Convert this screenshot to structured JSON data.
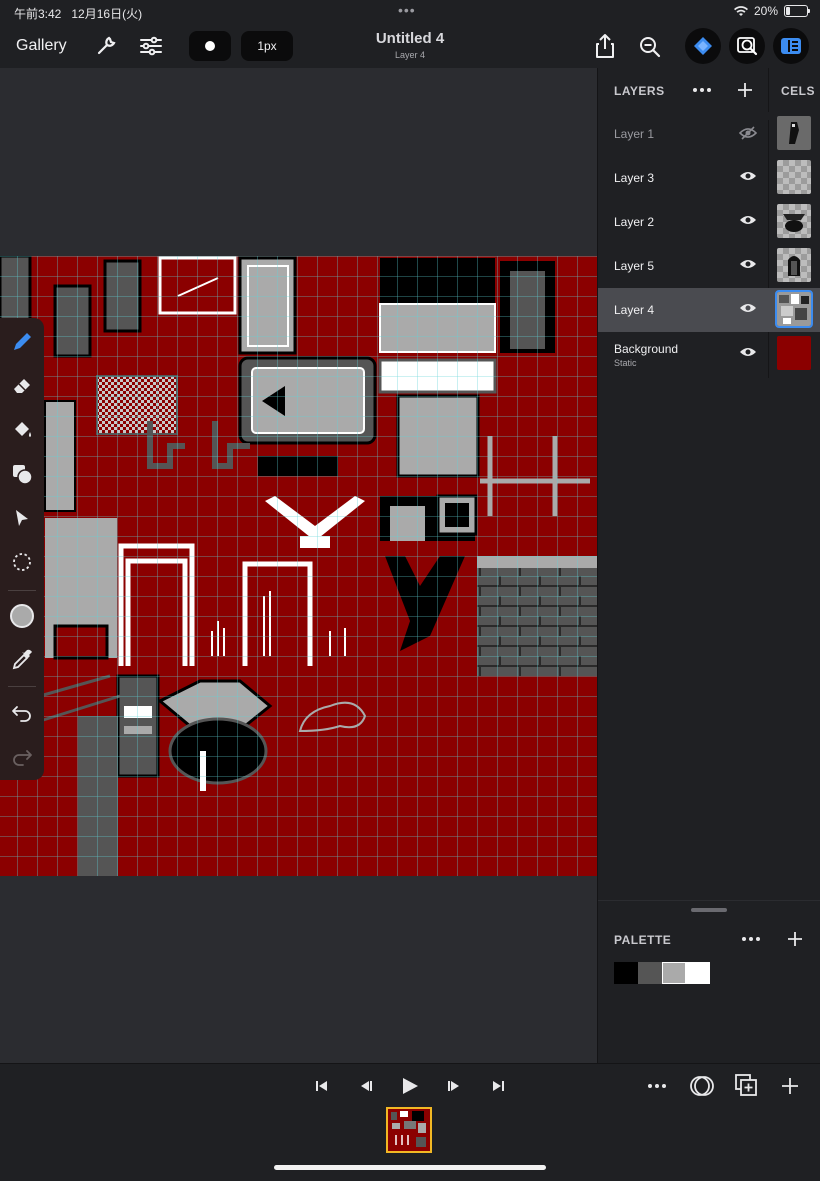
{
  "status_bar": {
    "time": "午前3:42",
    "date": "12月16日(火)",
    "dots": "•••",
    "battery": "20%"
  },
  "toolbar": {
    "gallery": "Gallery",
    "brush_size": "1px",
    "doc_title": "Untitled 4",
    "doc_subtitle": "Layer 4",
    "icons": [
      "wrench-icon",
      "sliders-icon",
      "share-icon",
      "zoom-out-icon",
      "layers-diamond-icon",
      "reference-icon",
      "panel-toggle-icon"
    ]
  },
  "tools": [
    "pencil-icon",
    "eraser-icon",
    "fill-bucket-icon",
    "shapes-icon",
    "move-arrow-icon",
    "lasso-select-icon",
    "color-swatch",
    "eyedropper-icon",
    "undo-icon",
    "redo-icon"
  ],
  "layers_panel": {
    "title": "LAYERS",
    "cels_title": "CELS",
    "layers": [
      {
        "name": "Layer 1",
        "hidden": true
      },
      {
        "name": "Layer 3",
        "hidden": false
      },
      {
        "name": "Layer 2",
        "hidden": false
      },
      {
        "name": "Layer 5",
        "hidden": false
      },
      {
        "name": "Layer 4",
        "hidden": false,
        "selected": true
      },
      {
        "name": "Background",
        "sub": "Static",
        "hidden": false
      }
    ]
  },
  "palette": {
    "title": "PALETTE",
    "colors": [
      "#000000",
      "#555555",
      "#aaaaaa",
      "#ffffff"
    ],
    "selected_index": 2
  },
  "colors": {
    "canvas_red": "#8b0000",
    "grid": "#5fd3d8",
    "accent": "#3c8cf0",
    "frame_border": "#f2b824"
  }
}
